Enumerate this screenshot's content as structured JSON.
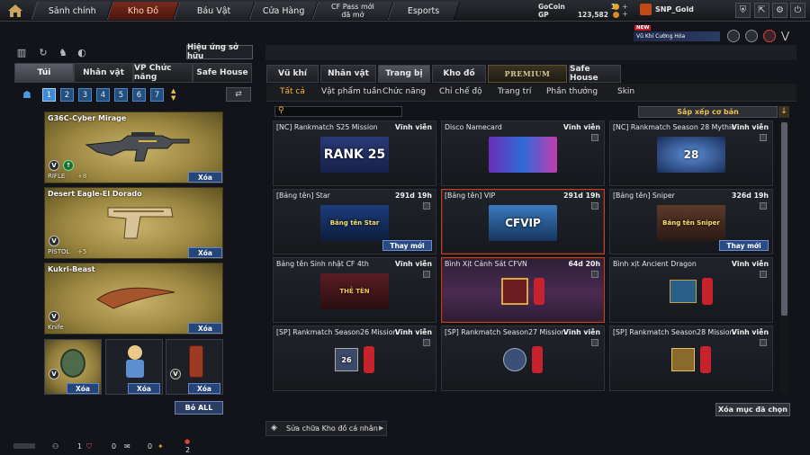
{
  "nav": {
    "tabs": [
      "Sảnh chính",
      "Kho Đồ",
      "Báu Vật",
      "Cửa Hàng",
      "CF Pass mới\nđã mở",
      "Esports"
    ],
    "active_tab": "Kho Đồ"
  },
  "currency": {
    "gocoin_label": "GoCoin",
    "gocoin_value": "1",
    "gp_label": "GP",
    "gp_value": "123,582"
  },
  "user": {
    "name": "SNP_Gold"
  },
  "header_banner": {
    "new_badge": "NEW",
    "text": "Vũ Khí Cường Hóa"
  },
  "left_panel": {
    "hieu_ung_button": "Hiệu ứng sở hữu",
    "tabs": [
      "Túi",
      "Nhân vật",
      "VP Chức năng",
      "Safe House"
    ],
    "active_tab": "Túi",
    "pages": [
      "1",
      "2",
      "3",
      "4",
      "5",
      "6",
      "7"
    ],
    "active_page": "1",
    "slots": [
      {
        "name": "G36C-Cyber Mirage",
        "type": "RIFLE",
        "bonus": "+8",
        "delete_label": "Xóa"
      },
      {
        "name": "Desert Eagle-El Dorado",
        "type": "PISTOL",
        "bonus": "+5",
        "delete_label": "Xóa"
      },
      {
        "name": "Kukri-Beast",
        "type": "Knife",
        "delete_label": "Xóa"
      }
    ],
    "small_slots": [
      {
        "delete_label": "Xóa"
      },
      {
        "delete_label": "Xóa"
      },
      {
        "delete_label": "Xóa"
      }
    ],
    "remove_all_button": "Bỏ ALL"
  },
  "main": {
    "tabs": [
      "Vũ khí",
      "Nhân vật",
      "Trang bị",
      "Kho đồ",
      "PREMIUM",
      "Safe House"
    ],
    "active_tab": "Trang bị",
    "sub_tabs": [
      "Tất cả",
      "Vật phẩm tuần",
      "Chức năng",
      "Chỉ chế độ",
      "Trang trí",
      "Phần thưởng",
      "Skin"
    ],
    "active_sub_tab": "Tất cả",
    "search_placeholder": "",
    "sort_button": "Sắp xếp cơ bản",
    "cards": [
      {
        "title": "[NC] Rankmatch S25 Mission",
        "duration": "Vĩnh viễn",
        "art": "RANK 25"
      },
      {
        "title": "Disco Namecard",
        "duration": "Vĩnh viễn",
        "art": ""
      },
      {
        "title": "[NC] Rankmatch Season 28 Mythical",
        "duration": "Vĩnh viễn",
        "art": "28"
      },
      {
        "title": "[Bảng tên] Star",
        "duration": "291d 19h",
        "art": "Bảng tên Star",
        "change_button": "Thay mới"
      },
      {
        "title": "[Bảng tên] VIP",
        "duration": "291d 19h",
        "art": "CFVIP",
        "highlight": true
      },
      {
        "title": "[Bảng tên] Sniper",
        "duration": "326d 19h",
        "art": "Bảng tên Sniper",
        "change_button": "Thay mới"
      },
      {
        "title": "Bảng tên Sinh nhật CF 4th",
        "duration": "Vĩnh viễn",
        "art": "THẺ TÊN"
      },
      {
        "title": "Bình Xịt Cảnh Sát CFVN",
        "duration": "64d 20h",
        "art": "",
        "highlight": true,
        "pink": true
      },
      {
        "title": "Bình xịt Ancient Dragon",
        "duration": "Vĩnh viễn",
        "art": ""
      },
      {
        "title": "[SP] Rankmatch Season26 Mission",
        "duration": "Vĩnh viễn",
        "art": "26"
      },
      {
        "title": "[SP] Rankmatch Season27 Mission",
        "duration": "Vĩnh viễn",
        "art": ""
      },
      {
        "title": "[SP] Rankmatch Season28 Mission",
        "duration": "Vĩnh viễn",
        "art": ""
      }
    ],
    "delete_selected_button": "Xóa mục đã chọn",
    "repair_button": "Sửa chữa Kho đồ cá nhân"
  },
  "status_bar": {
    "count1": "1",
    "count2": "0",
    "count3": "0",
    "count4": "2"
  },
  "colors": {
    "accent_tab": "#7a2a1c",
    "highlight_orange": "#ffb43b",
    "blue_button": "#25447a"
  }
}
